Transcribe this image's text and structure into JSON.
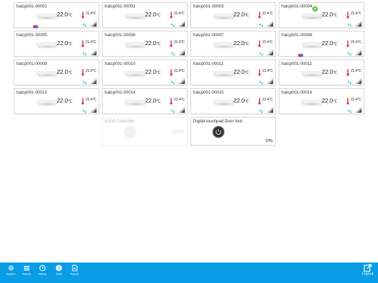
{
  "tiles": [
    {
      "name": "hatcp001-00001",
      "temp": "22.0",
      "temp_unit": "℃",
      "humidity": "21.4",
      "humidity_unit": "℃",
      "has_dot": true,
      "has_badge": false
    },
    {
      "name": "hatcp001-00002",
      "temp": "22.0",
      "temp_unit": "℃",
      "humidity": "21.4",
      "humidity_unit": "℃",
      "has_dot": false,
      "has_badge": false
    },
    {
      "name": "hatcp001-00003",
      "temp": "22.0",
      "temp_unit": "℃",
      "humidity": "21.4",
      "humidity_unit": "℃",
      "has_dot": false,
      "has_badge": false
    },
    {
      "name": "hatcp001-00004",
      "temp": "22.0",
      "temp_unit": "℃",
      "humidity": "21.4",
      "humidity_unit": "℃",
      "has_dot": false,
      "has_badge": true
    },
    {
      "name": "hatcp001-00005",
      "temp": "22.0",
      "temp_unit": "℃",
      "humidity": "21.4",
      "humidity_unit": "℃",
      "has_dot": false,
      "has_badge": false
    },
    {
      "name": "hatcp001-00006",
      "temp": "22.0",
      "temp_unit": "℃",
      "humidity": "21.4",
      "humidity_unit": "℃",
      "has_dot": false,
      "has_badge": false
    },
    {
      "name": "hatcp001-00007",
      "temp": "22.0",
      "temp_unit": "℃",
      "humidity": "21.4",
      "humidity_unit": "℃",
      "has_dot": false,
      "has_badge": false
    },
    {
      "name": "hatcp001-00008",
      "temp": "22.0",
      "temp_unit": "℃",
      "humidity": "21.4",
      "humidity_unit": "℃",
      "has_dot": true,
      "has_badge": false
    },
    {
      "name": "hatcp001-00009",
      "temp": "22.0",
      "temp_unit": "℃",
      "humidity": "21.4",
      "humidity_unit": "℃",
      "has_dot": false,
      "has_badge": false
    },
    {
      "name": "hatcp001-00010",
      "temp": "22.0",
      "temp_unit": "℃",
      "humidity": "21.4",
      "humidity_unit": "℃",
      "has_dot": false,
      "has_badge": false
    },
    {
      "name": "hatcp001-00011",
      "temp": "22.0",
      "temp_unit": "℃",
      "humidity": "21.4",
      "humidity_unit": "℃",
      "has_dot": false,
      "has_badge": false
    },
    {
      "name": "hatcp001-00012",
      "temp": "22.0",
      "temp_unit": "℃",
      "humidity": "21.4",
      "humidity_unit": "℃",
      "has_dot": false,
      "has_badge": false
    },
    {
      "name": "hatcp001-00013",
      "temp": "22.0",
      "temp_unit": "℃",
      "humidity": "21.4",
      "humidity_unit": "℃",
      "has_dot": false,
      "has_badge": false
    },
    {
      "name": "hatcp001-00014",
      "temp": "22.0",
      "temp_unit": "℃",
      "humidity": "21.4",
      "humidity_unit": "℃",
      "has_dot": false,
      "has_badge": false
    },
    {
      "name": "hatcp001-00015",
      "temp": "22.0",
      "temp_unit": "℃",
      "humidity": "21.4",
      "humidity_unit": "℃",
      "has_dot": false,
      "has_badge": false
    },
    {
      "name": "hatcp001-00016",
      "temp": "22.0",
      "temp_unit": "℃",
      "humidity": "21.4",
      "humidity_unit": "℃",
      "has_dot": false,
      "has_badge": false
    }
  ],
  "extra_tiles": {
    "disabled": {
      "name": "KA00 Controller",
      "value": "100%"
    },
    "doorlock": {
      "name": "Digital touchpad Door lock",
      "value": "0%"
    }
  },
  "nav": [
    {
      "label": "System",
      "icon": "gear-icon"
    },
    {
      "label": "Scenes",
      "icon": "scenes-icon"
    },
    {
      "label": "History",
      "icon": "clock-icon"
    },
    {
      "label": "Data",
      "icon": "info-icon"
    },
    {
      "label": "Report",
      "icon": "report-icon"
    }
  ],
  "logout": {
    "label": "Logout",
    "icon": "logout-icon"
  },
  "colors": {
    "accent": "#0a9de6",
    "badge": "#6ac84a",
    "thermometer": "#d43b66",
    "drops": "#5fd4e6"
  }
}
